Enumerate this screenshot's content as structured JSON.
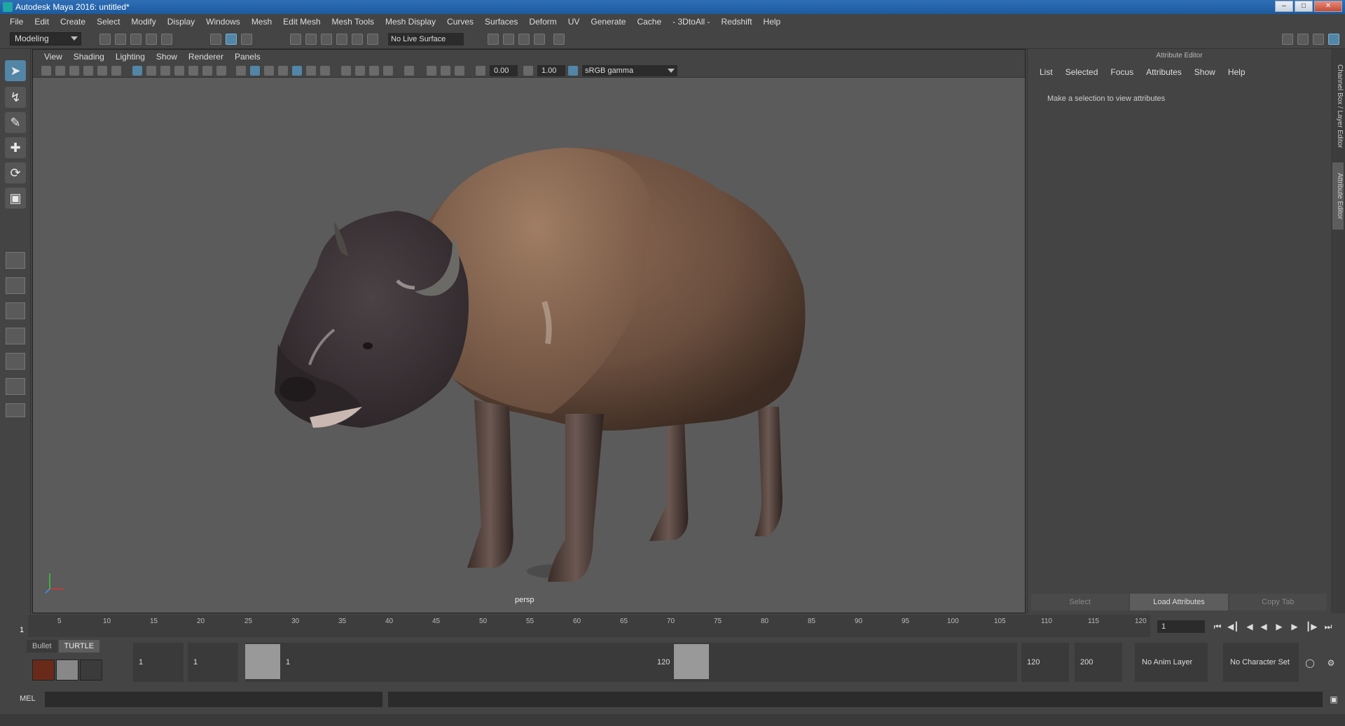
{
  "window": {
    "title": "Autodesk Maya 2016: untitled*"
  },
  "menubar": {
    "items": [
      "File",
      "Edit",
      "Create",
      "Select",
      "Modify",
      "Display",
      "Windows",
      "Mesh",
      "Edit Mesh",
      "Mesh Tools",
      "Mesh Display",
      "Curves",
      "Surfaces",
      "Deform",
      "UV",
      "Generate",
      "Cache",
      "- 3DtoAll -",
      "Redshift",
      "Help"
    ]
  },
  "shelfbar": {
    "mode": "Modeling",
    "live_surface": "No Live Surface"
  },
  "panel": {
    "menu": [
      "View",
      "Shading",
      "Lighting",
      "Show",
      "Renderer",
      "Panels"
    ],
    "exposure": "0.00",
    "gamma": "1.00",
    "color_space": "sRGB gamma",
    "camera": "persp"
  },
  "attribute_editor": {
    "title": "Attribute Editor",
    "menu": [
      "List",
      "Selected",
      "Focus",
      "Attributes",
      "Show",
      "Help"
    ],
    "message": "Make a selection to view attributes",
    "buttons": {
      "select": "Select",
      "load": "Load Attributes",
      "copy": "Copy Tab"
    },
    "side_tabs": [
      "Channel Box / Layer Editor",
      "Attribute Editor"
    ]
  },
  "timeslider": {
    "current_frame": "1",
    "ticks": [
      "5",
      "10",
      "15",
      "20",
      "25",
      "30",
      "35",
      "40",
      "45",
      "50",
      "55",
      "60",
      "65",
      "70",
      "75",
      "80",
      "85",
      "90",
      "95",
      "100",
      "105",
      "110",
      "115",
      "120"
    ],
    "frame_field": "1"
  },
  "rangebar": {
    "shelf_tabs": [
      "Bullet",
      "TURTLE"
    ],
    "start_frame": "1",
    "playback_start": "1",
    "range_start_label": "1",
    "range_end_label": "120",
    "playback_end": "120",
    "end_frame": "200",
    "anim_layer": "No Anim Layer",
    "character_set": "No Character Set"
  },
  "cmdline": {
    "label": "MEL"
  },
  "colors": {
    "viewport_bg": "#5b5b5b",
    "ui_bg": "#444444",
    "accent": "#5285a6",
    "titlebar": "#2a67ac"
  }
}
